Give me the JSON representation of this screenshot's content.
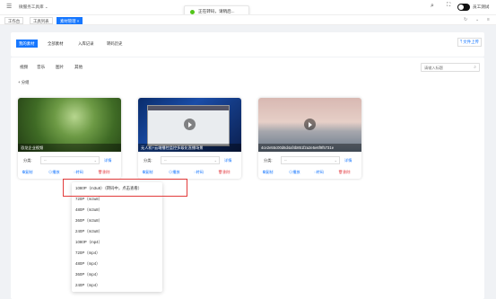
{
  "header": {
    "app_title": "微服务工具库",
    "title_caret": "⌄",
    "user_name": "员工测试"
  },
  "toast": {
    "message": "正在转码，请稍后..."
  },
  "page_tabs": {
    "workbench": "工作台",
    "tools": "工具列表",
    "material": "素材管理 ×"
  },
  "sub_tabs": [
    "我的素材",
    "全部素材",
    "入库记录",
    "转码历史"
  ],
  "upload_label": "文件上传",
  "filter_tabs": [
    "视频",
    "音乐",
    "图片",
    "其他"
  ],
  "add_group_label": "+ 分组",
  "search": {
    "placeholder": "请输入标题"
  },
  "cards": [
    {
      "caption": "恐龙企业视频",
      "category_label": "分类:",
      "category_value": "--",
      "detail": "详情",
      "actions": {
        "copy": "复制",
        "play": "播放",
        "transcode": "转码",
        "delete": "删除"
      }
    },
    {
      "caption": "无人机+云端播控监控多级化直播场景",
      "category_label": "分类:",
      "category_value": "--",
      "detail": "详情",
      "actions": {
        "copy": "复制",
        "play": "播放",
        "transcode": "转码",
        "delete": "删除"
      }
    },
    {
      "caption": "4ce2e55c00d6d4af4b851f2a2e5e6f9f5731e",
      "category_label": "分类:",
      "category_value": "--",
      "detail": "详情",
      "actions": {
        "copy": "复制",
        "play": "播放",
        "transcode": "转码",
        "delete": "删除"
      }
    }
  ],
  "transcode_dropdown": {
    "options": [
      "1080P（m3u8）（转码中，点击查看）",
      "720P（m3u8）",
      "480P（m3u8）",
      "360P（m3u8）",
      "240P（m3u8）",
      "1080P（mp4）",
      "720P（mp4）",
      "480P（mp4）",
      "360P（mp4）",
      "240P（mp4）"
    ]
  },
  "colors": {
    "primary": "#1677ff",
    "danger": "#e5484d",
    "success": "#52c41a"
  }
}
